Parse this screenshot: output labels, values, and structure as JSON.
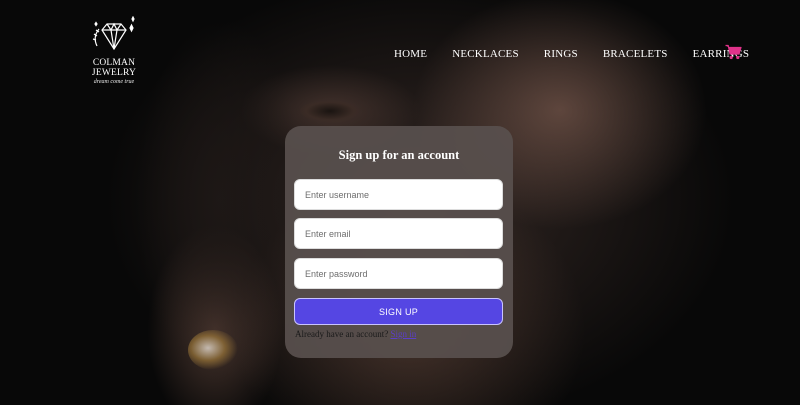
{
  "brand": {
    "name": "COLMAN JEWELRY",
    "tagline": "dream come true"
  },
  "nav": {
    "items": [
      {
        "label": "HOME"
      },
      {
        "label": "NECKLACES"
      },
      {
        "label": "RINGS"
      },
      {
        "label": "BRACELETS"
      },
      {
        "label": "EARRINGS"
      }
    ],
    "cart_icon": "shopping-cart-icon"
  },
  "signup": {
    "title": "Sign up for an account",
    "username_placeholder": "Enter username",
    "email_placeholder": "Enter email",
    "password_placeholder": "Enter password",
    "submit_label": "SIGN UP",
    "have_account_text": "Already have an account?",
    "signin_link": "Sign in"
  },
  "colors": {
    "accent": "#5546e3",
    "cart": "#e0338a",
    "card": "#58504d"
  }
}
